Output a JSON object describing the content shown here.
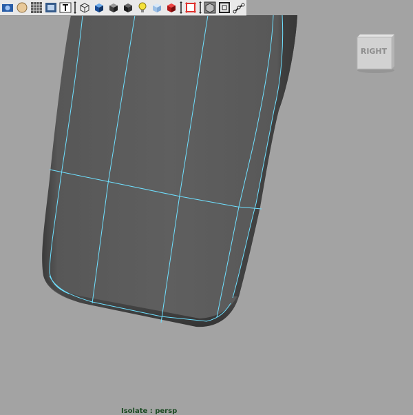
{
  "toolbar": {
    "buttons": [
      {
        "icon": "camera-icon"
      },
      {
        "icon": "sphere-shade-icon"
      },
      {
        "icon": "grid-icon"
      },
      {
        "icon": "film-gate-icon"
      },
      {
        "icon": "text-icon"
      },
      {
        "icon": "wireframe-cube-icon"
      },
      {
        "icon": "smooth-shade-cube-icon"
      },
      {
        "icon": "flat-shade-cube-icon"
      },
      {
        "icon": "bounding-box-cube-icon"
      },
      {
        "icon": "light-bulb-icon"
      },
      {
        "icon": "xray-icon"
      },
      {
        "icon": "textured-cube-icon"
      },
      {
        "icon": "isolate-select-icon"
      },
      {
        "icon": "xray-joints-icon"
      },
      {
        "icon": "frame-all-icon"
      },
      {
        "icon": "skeleton-joint-icon"
      }
    ]
  },
  "viewcube": {
    "label": "RIGHT"
  },
  "viewport": {
    "label": "Isolate : persp"
  },
  "colors": {
    "background": "#a3a3a3",
    "mesh": "#5c5c5c",
    "wire": "#6fe0ff"
  }
}
